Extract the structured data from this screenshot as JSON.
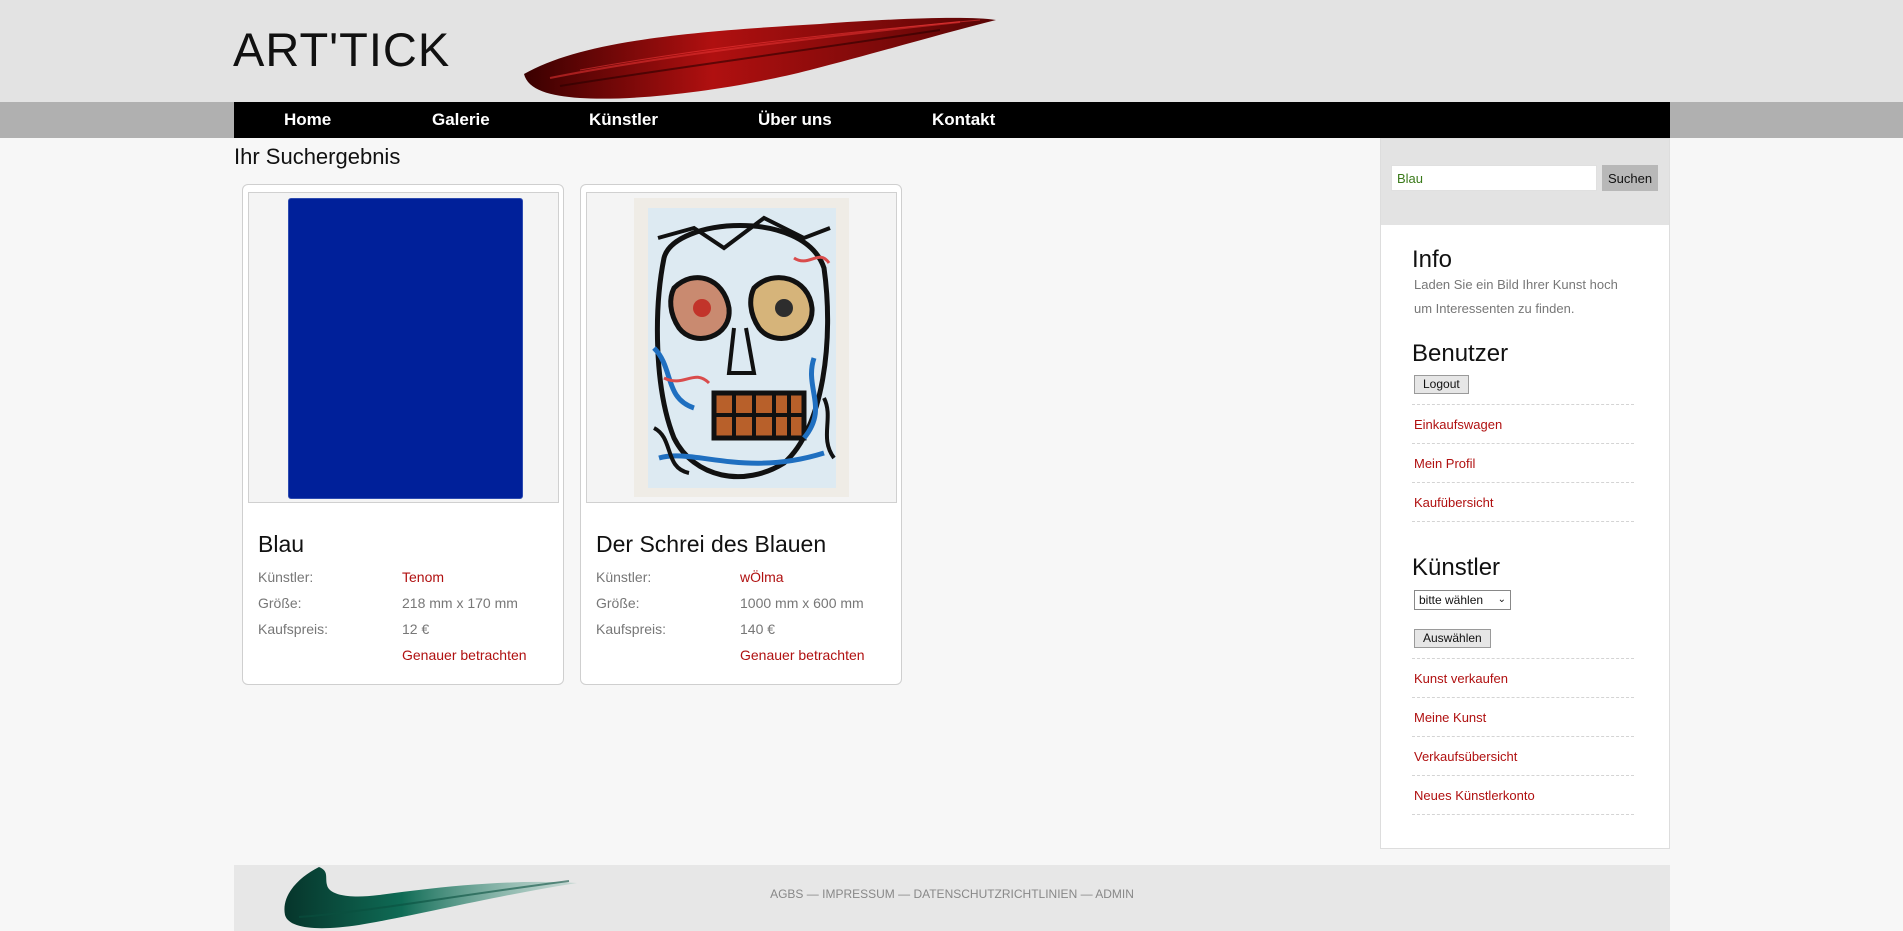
{
  "header": {
    "logo": "ART'TICK",
    "colors": {
      "brush_red": "#b01010",
      "brush_green": "#0f6b55"
    }
  },
  "nav": {
    "items": [
      {
        "label": "Home"
      },
      {
        "label": "Galerie"
      },
      {
        "label": "Künstler"
      },
      {
        "label": "Über uns"
      },
      {
        "label": "Kontakt"
      }
    ]
  },
  "main": {
    "title": "Ihr Suchergebnis",
    "cards": [
      {
        "title": "Blau",
        "artist_label": "Künstler:",
        "artist": "Tenom",
        "size_label": "Größe:",
        "size": "218 mm x 170 mm",
        "price_label": "Kaufspreis:",
        "price": "12 €",
        "link": "Genauer betrachten",
        "image_color": "#00209a"
      },
      {
        "title": "Der Schrei des Blauen",
        "artist_label": "Künstler:",
        "artist": "wÖlma",
        "size_label": "Größe:",
        "size": "1000 mm x 600 mm",
        "price_label": "Kaufspreis:",
        "price": "140 €",
        "link": "Genauer betrachten"
      }
    ]
  },
  "sidebar": {
    "search": {
      "value": "Blau",
      "button": "Suchen"
    },
    "info": {
      "heading": "Info",
      "text": "Laden Sie ein Bild Ihrer Kunst hoch um Interessenten zu finden."
    },
    "user": {
      "heading": "Benutzer",
      "logout": "Logout",
      "links": [
        "Einkaufswagen",
        "Mein Profil",
        "Kaufübersicht"
      ]
    },
    "artists": {
      "heading": "Künstler",
      "select_value": "bitte wählen",
      "select_button": "Auswählen",
      "links": [
        "Kunst verkaufen",
        "Meine Kunst",
        "Verkaufsübersicht",
        "Neues Künstlerkonto"
      ]
    }
  },
  "footer": {
    "links": "AGBS — IMPRESSUM — DATENSCHUTZRICHTLINIEN — ADMIN"
  }
}
